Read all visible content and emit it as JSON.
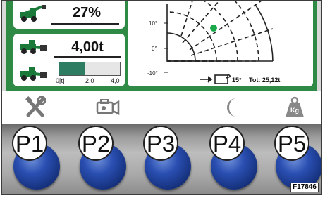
{
  "load_card": {
    "percent": "27%"
  },
  "weight_card": {
    "value": "4,00t",
    "gauge": {
      "fill_fraction": 0.43,
      "ticks": [
        "0[t]",
        "2,0",
        "4,0"
      ]
    }
  },
  "chart": {
    "y_ticks": [
      "10°",
      "0°",
      "-10°"
    ],
    "tilt_label": "15°",
    "total_label": "Tot: 25,12t",
    "marker_color": "#1aa84a"
  },
  "function_icons": [
    "tools-icon",
    "camera-icon",
    "moon-icon",
    "weight-kg-icon"
  ],
  "weight_icon_label": "Kg",
  "buttons": [
    "P1",
    "P2",
    "P3",
    "P4",
    "P5"
  ],
  "figure_id": "F17846",
  "colors": {
    "screen_bg": "#2f8a46",
    "button_blue": "#2a4fb2",
    "gauge_fill": "#2e7d63"
  }
}
